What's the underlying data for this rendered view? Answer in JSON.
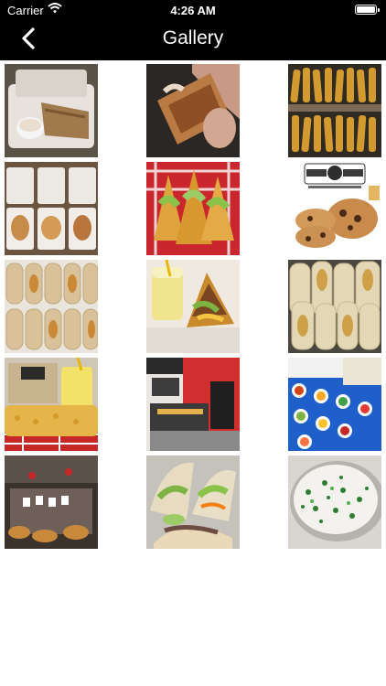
{
  "status_bar": {
    "carrier": "Carrier",
    "time": "4:26 AM"
  },
  "nav": {
    "title": "Gallery"
  },
  "gallery": {
    "images": [
      "Taco Boyz burrito in takeout box with sauce cup",
      "Hand holding grilled wrap",
      "Tray of rolled taquitos",
      "Open takeout boxes of food",
      "Basket of crispy tacos",
      "Taco Boyz chocolate chip cookies",
      "Rows of wrapped burritos",
      "Drink with crispy tacos",
      "Tray of burritos",
      "Taco Boyz bag, drink and churro",
      "Restaurant interior counter",
      "Toppings bar on blue table",
      "Catering spread on table",
      "Soft tacos with toppings",
      "Bowl of rice with cilantro"
    ]
  }
}
